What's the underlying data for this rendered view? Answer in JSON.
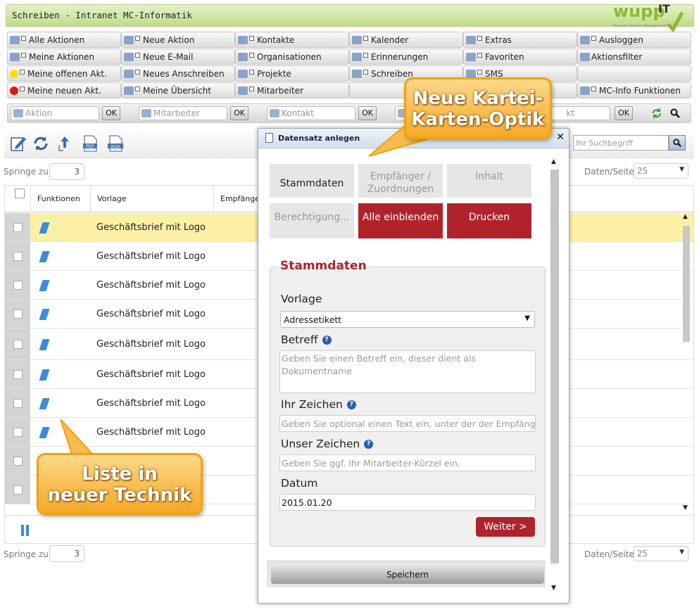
{
  "window": {
    "title": "Schreiben - Intranet MC-Informatik"
  },
  "logo": {
    "text": "wupp",
    "suffix": "IT",
    "tagline": "Business-Process-Management"
  },
  "menu": {
    "rows": [
      [
        "Alle Aktionen",
        "Neue Aktion",
        "Kontakte",
        "Kalender",
        "Extras",
        "Ausloggen"
      ],
      [
        "Meine Aktionen",
        "Neue E-Mail",
        "Organisationen",
        "Erinnerungen",
        "Favoriten",
        "Aktionsfilter"
      ],
      [
        "Meine offenen Akt.",
        "Neues Anschreiben",
        "Projekte",
        "Schreiben",
        "SMS",
        ""
      ],
      [
        "Meine neuen Akt.",
        "Meine Übersicht",
        "Mitarbeiter",
        "",
        "",
        "MC-Info Funktionen"
      ]
    ]
  },
  "quicksearch": {
    "fields": [
      {
        "placeholder": "Aktion",
        "ok": "OK"
      },
      {
        "placeholder": "Mitarbeiter",
        "ok": "OK"
      },
      {
        "placeholder": "Kontakt",
        "ok": "OK"
      },
      {
        "placeholder": "kt",
        "ok": "OK"
      }
    ]
  },
  "toolbar": {
    "search_placeholder": "Ihr Suchbegriff"
  },
  "pager": {
    "jump_label": "Springe zu:",
    "jump_value": "3",
    "per_page_label": "Daten/Seite:",
    "per_page_value": "25"
  },
  "grid": {
    "columns": [
      "Funktionen",
      "Vorlage",
      "Empfänger"
    ],
    "rows": [
      {
        "vorlage": "Geschäftsbrief mit Logo",
        "selected": true
      },
      {
        "vorlage": "Geschäftsbrief mit Logo"
      },
      {
        "vorlage": "Geschäftsbrief mit Logo"
      },
      {
        "vorlage": "Geschäftsbrief mit Logo"
      },
      {
        "vorlage": "Geschäftsbrief mit Logo"
      },
      {
        "vorlage": "Geschäftsbrief mit Logo"
      },
      {
        "vorlage": "Geschäftsbrief mit Logo"
      },
      {
        "vorlage": "Geschäftsbrief mit Logo"
      },
      {
        "vorlage": ""
      },
      {
        "vorlage": ""
      }
    ]
  },
  "callouts": {
    "top": "Neue Kartei-\nKarten-Optik",
    "bottom": "Liste in\nneuer Technik"
  },
  "dialog": {
    "title": "Datensatz anlegen",
    "tabs": [
      {
        "label": "Stammdaten",
        "state": "active"
      },
      {
        "label": "Empfänger / Zuordnungen",
        "state": "disabled"
      },
      {
        "label": "Inhalt",
        "state": "disabled"
      },
      {
        "label": "Berechtigung...",
        "state": "disabled"
      },
      {
        "label": "Alle einblenden",
        "state": "action"
      },
      {
        "label": "Drucken",
        "state": "action"
      }
    ],
    "section_title": "Stammdaten",
    "fields": {
      "vorlage": {
        "label": "Vorlage",
        "value": "Adressetikett"
      },
      "betreff": {
        "label": "Betreff",
        "placeholder": "Geben Sie einen Betreff ein, dieser dient als Dokumentname"
      },
      "ihr_zeichen": {
        "label": "Ihr Zeichen",
        "placeholder": "Geben Sie optional einen Text ein, unter der der Empfänger"
      },
      "unser_zeichen": {
        "label": "Unser Zeichen",
        "placeholder": "Geben Sie ggf. Ihr Mitarbeiter-Kürzel ein."
      },
      "datum": {
        "label": "Datum",
        "value": "2015.01.20"
      }
    },
    "next_button": "Weiter >",
    "save_button": "Speichern"
  }
}
